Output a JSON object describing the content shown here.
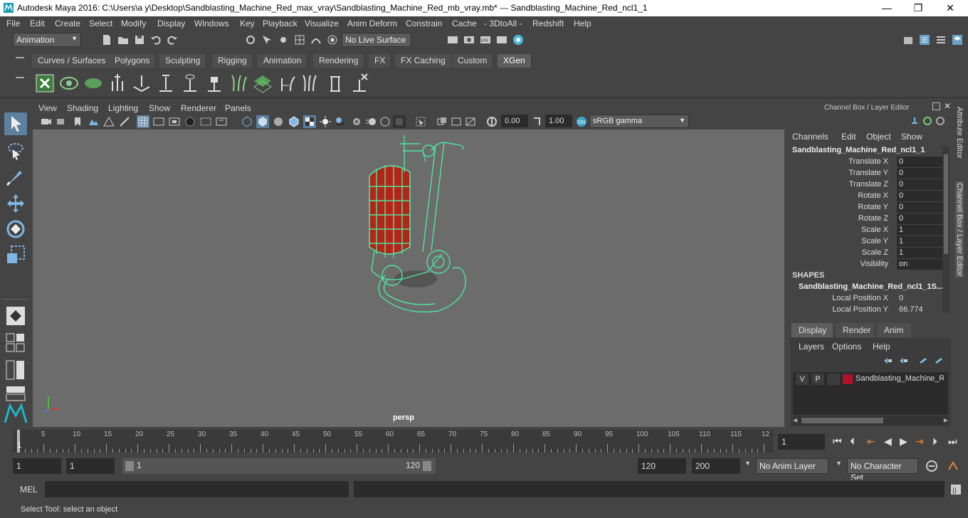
{
  "window": {
    "title": "Autodesk Maya 2016: C:\\Users\\a y\\Desktop\\Sandblasting_Machine_Red_max_vray\\Sandblasting_Machine_Red_mb_vray.mb*   ---   Sandblasting_Machine_Red_ncl1_1",
    "minimize": "—",
    "maximize": "❐",
    "close": "✕"
  },
  "menubar": [
    "File",
    "Edit",
    "Create",
    "Select",
    "Modify",
    "Display",
    "Windows",
    "Key",
    "Playback",
    "Visualize",
    "Anim Deform",
    "Constrain",
    "Cache",
    "- 3DtoAll -",
    "Redshift",
    "Help"
  ],
  "statusline": {
    "mode": "Animation",
    "live_surface": "No Live Surface"
  },
  "shelf_tabs": [
    "Curves / Surfaces",
    "Polygons",
    "Sculpting",
    "Rigging",
    "Animation",
    "Rendering",
    "FX",
    "FX Caching",
    "Custom",
    "XGen"
  ],
  "shelf_active": "XGen",
  "viewport": {
    "menu": [
      "View",
      "Shading",
      "Lighting",
      "Show",
      "Renderer",
      "Panels"
    ],
    "field1": "0.00",
    "field2": "1.00",
    "color_space": "sRGB gamma",
    "camera_label": "persp"
  },
  "channel_box": {
    "header": "Channel Box / Layer Editor",
    "menu": [
      "Channels",
      "Edit",
      "Object",
      "Show"
    ],
    "object_name": "Sandblasting_Machine_Red_ncl1_1",
    "attributes": [
      {
        "label": "Translate X",
        "value": "0"
      },
      {
        "label": "Translate Y",
        "value": "0"
      },
      {
        "label": "Translate Z",
        "value": "0"
      },
      {
        "label": "Rotate X",
        "value": "0"
      },
      {
        "label": "Rotate Y",
        "value": "0"
      },
      {
        "label": "Rotate Z",
        "value": "0"
      },
      {
        "label": "Scale X",
        "value": "1"
      },
      {
        "label": "Scale Y",
        "value": "1"
      },
      {
        "label": "Scale Z",
        "value": "1"
      },
      {
        "label": "Visibility",
        "value": "on"
      }
    ],
    "shapes_header": "SHAPES",
    "shape_name": "Sandblasting_Machine_Red_ncl1_1S...",
    "shape_attributes": [
      {
        "label": "Local Position X",
        "value": "0"
      },
      {
        "label": "Local Position Y",
        "value": "66.774"
      }
    ]
  },
  "side_tabs": [
    "Attribute Editor",
    "Channel Box / Layer Editor"
  ],
  "layer_editor": {
    "tabs": [
      "Display",
      "Render",
      "Anim"
    ],
    "menu": [
      "Layers",
      "Options",
      "Help"
    ],
    "layer": {
      "v": "V",
      "p": "P",
      "name": "Sandblasting_Machine_R",
      "color": "#b0102a"
    }
  },
  "timeline": {
    "ticks": [
      "5",
      "10",
      "15",
      "20",
      "25",
      "30",
      "35",
      "40",
      "45",
      "50",
      "55",
      "60",
      "65",
      "70",
      "75",
      "80",
      "85",
      "90",
      "95",
      "100",
      "105",
      "110",
      "115",
      "12"
    ],
    "current_frame_marker": "1",
    "current_frame": "1"
  },
  "range": {
    "start": "1",
    "playback_start": "1",
    "slider_start": "1",
    "slider_end": "120",
    "playback_end": "120",
    "end": "200",
    "anim_layer": "No Anim Layer",
    "character_set": "No Character Set"
  },
  "mel": {
    "label": "MEL"
  },
  "help_line": "Select Tool: select an object",
  "colors": {
    "wireframe": "#4fe3a0",
    "tank": "#b42418",
    "viewport_bg": "#6c6c6c"
  }
}
